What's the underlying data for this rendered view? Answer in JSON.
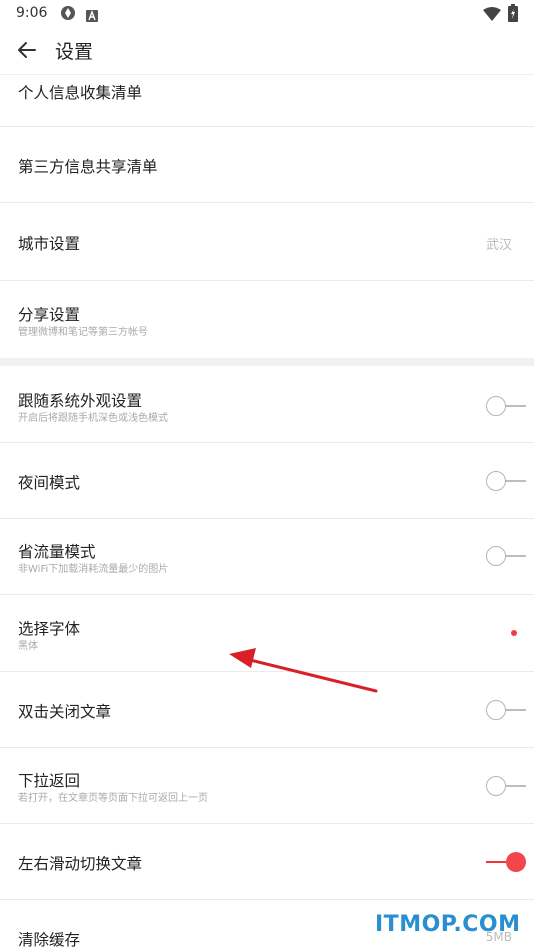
{
  "status_bar": {
    "time": "9:06",
    "icons": [
      "sync-app-icon",
      "a-badge-icon",
      "wifi-icon",
      "battery-charging-icon"
    ]
  },
  "header": {
    "title": "设置",
    "back_icon": "arrow-back-icon"
  },
  "settings": [
    {
      "title": "个人信息收集清单"
    },
    {
      "title": "第三方信息共享清单"
    },
    {
      "title": "城市设置",
      "value": "武汉"
    },
    {
      "title": "分享设置",
      "subtitle": "管理微博和笔记等第三方帐号"
    },
    {
      "title": "跟随系统外观设置",
      "subtitle": "开启后将跟随手机深色或浅色模式",
      "toggle": "off"
    },
    {
      "title": "夜间模式",
      "toggle": "off"
    },
    {
      "title": "省流量模式",
      "subtitle": "非WiFi下加载消耗流量最少的图片",
      "toggle": "off"
    },
    {
      "title": "选择字体",
      "subtitle": "黑体",
      "indicator": "red-dot"
    },
    {
      "title": "双击关闭文章",
      "toggle": "off"
    },
    {
      "title": "下拉返回",
      "subtitle": "若打开，在文章页等页面下拉可返回上一页",
      "toggle": "off"
    },
    {
      "title": "左右滑动切换文章",
      "toggle": "on"
    },
    {
      "title": "清除缓存",
      "value": "5MB"
    }
  ],
  "watermark": "ITMOP.COM",
  "colors": {
    "accent": "#f23b42",
    "annotation_arrow": "#d92027",
    "watermark": "#2a8fd0"
  }
}
